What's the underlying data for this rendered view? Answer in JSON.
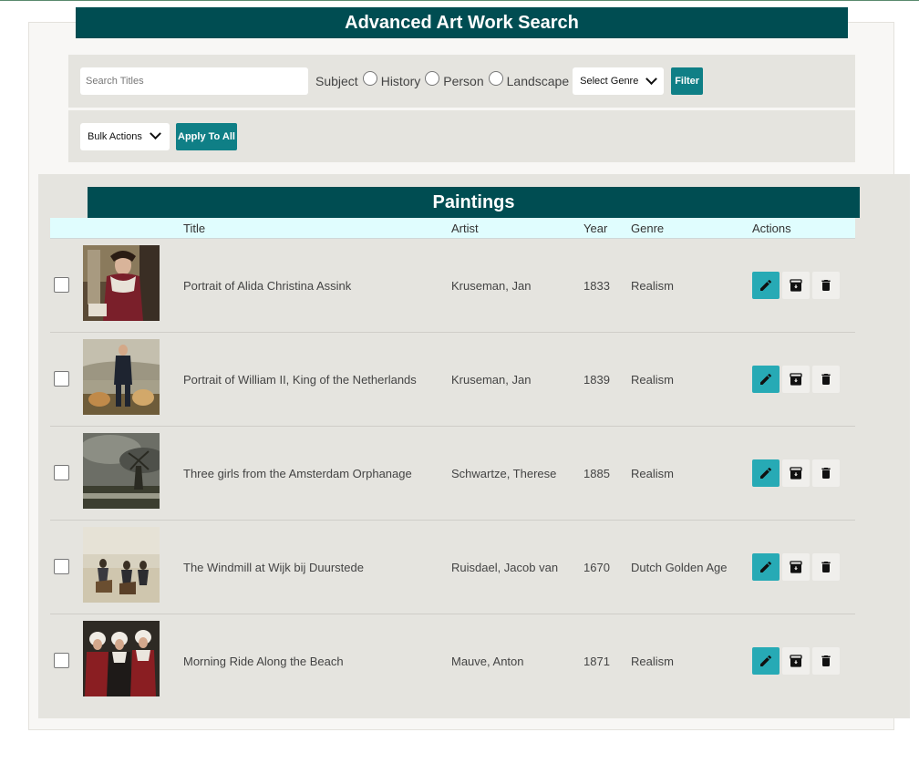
{
  "header": {
    "title": "Advanced Art Work Search"
  },
  "filters": {
    "search_placeholder": "Search Titles",
    "subject_label": "Subject",
    "subjects": [
      "History",
      "Person",
      "Landscape"
    ],
    "genre_select": "Select Genre",
    "filter_button": "Filter"
  },
  "bulk": {
    "select_label": "Bulk Actions",
    "apply_button": "Apply To All"
  },
  "table": {
    "title": "Paintings",
    "columns": {
      "title": "Title",
      "artist": "Artist",
      "year": "Year",
      "genre": "Genre",
      "actions": "Actions"
    },
    "rows": [
      {
        "title": "Portrait of Alida Christina Assink",
        "artist": "Kruseman, Jan",
        "year": "1833",
        "genre": "Realism"
      },
      {
        "title": "Portrait of William II, King of the Netherlands",
        "artist": "Kruseman, Jan",
        "year": "1839",
        "genre": "Realism"
      },
      {
        "title": "Three girls from the Amsterdam Orphanage",
        "artist": "Schwartze, Therese",
        "year": "1885",
        "genre": "Realism"
      },
      {
        "title": "The Windmill at Wijk bij Duurstede",
        "artist": "Ruisdael, Jacob van",
        "year": "1670",
        "genre": "Dutch Golden Age"
      },
      {
        "title": "Morning Ride Along the Beach",
        "artist": "Mauve, Anton",
        "year": "1871",
        "genre": "Realism"
      }
    ]
  },
  "icons": {
    "edit": "pencil-icon",
    "archive": "archive-icon",
    "delete": "trash-icon"
  },
  "colors": {
    "header_bg": "#004d52",
    "button_teal": "#0f7f86",
    "edit_button": "#27aab5",
    "table_header_bg": "#e0fdfe"
  }
}
